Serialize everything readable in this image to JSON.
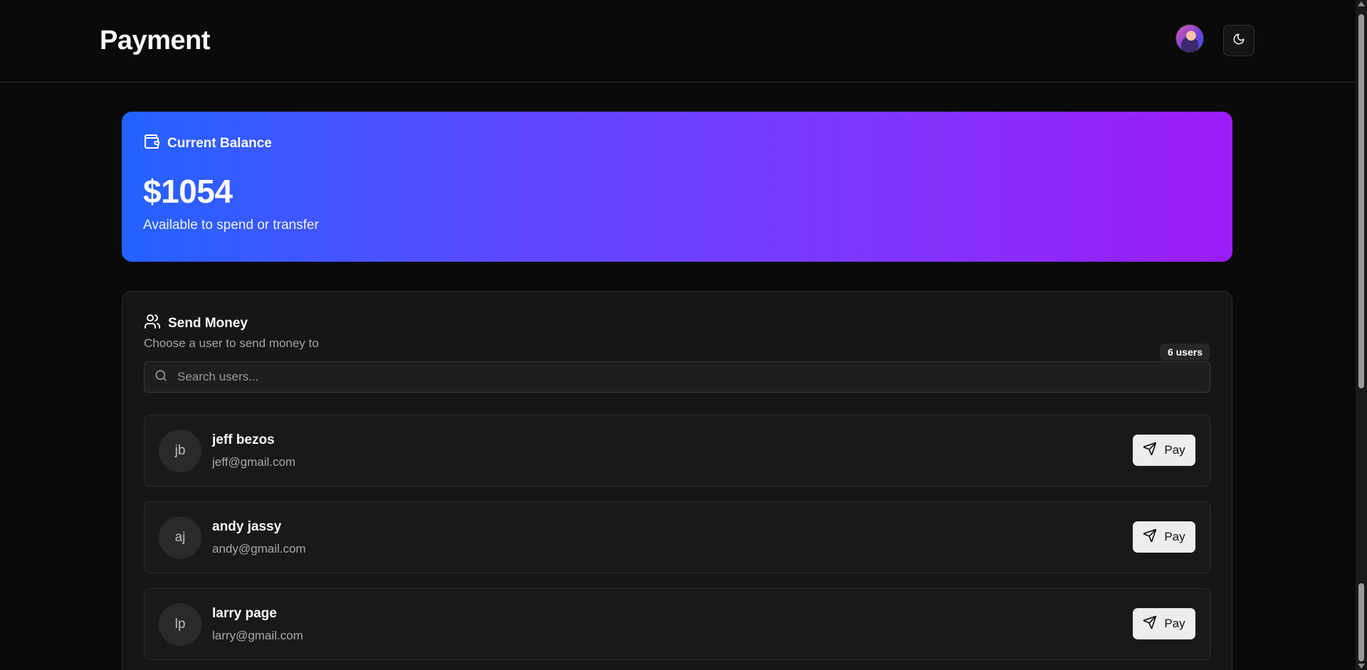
{
  "header": {
    "title": "Payment",
    "avatar_alt": "User avatar",
    "theme_toggle_icon": "moon-icon"
  },
  "balance": {
    "label": "Current Balance",
    "amount": "$1054",
    "subtitle": "Available to spend or transfer",
    "icon": "wallet-icon",
    "gradient_start": "#2462ff",
    "gradient_end": "#9c1cf6"
  },
  "send_money": {
    "title": "Send Money",
    "subtitle": "Choose a user to send money to",
    "user_count": "6 users",
    "icon": "users-icon",
    "search": {
      "placeholder": "Search users...",
      "value": ""
    },
    "users": [
      {
        "initials": "jb",
        "name": "jeff bezos",
        "email": "jeff@gmail.com",
        "pay_label": "Pay"
      },
      {
        "initials": "aj",
        "name": "andy jassy",
        "email": "andy@gmail.com",
        "pay_label": "Pay"
      },
      {
        "initials": "lp",
        "name": "larry page",
        "email": "larry@gmail.com",
        "pay_label": "Pay"
      }
    ]
  }
}
